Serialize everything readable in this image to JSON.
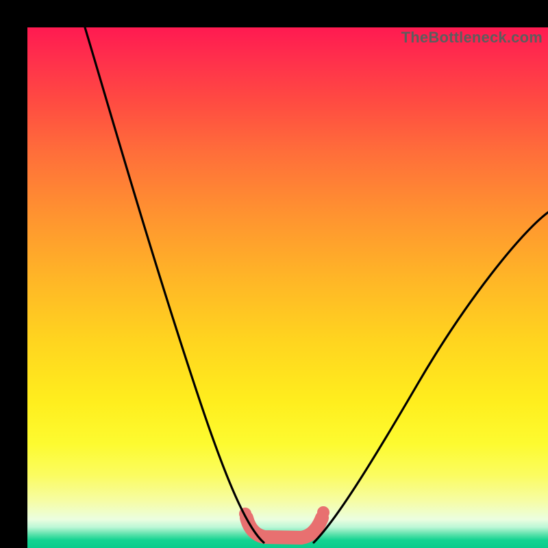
{
  "watermark_text": "TheBottleneck.com",
  "chart_data": {
    "type": "line",
    "title": "",
    "xlabel": "",
    "ylabel": "",
    "xlim": [
      0,
      100
    ],
    "ylim": [
      0,
      100
    ],
    "series": [
      {
        "name": "left-curve",
        "x": [
          11,
          15,
          20,
          25,
          30,
          35,
          38,
          41,
          43,
          45
        ],
        "y": [
          100,
          90,
          78,
          64,
          48,
          30,
          18,
          8,
          2,
          0
        ]
      },
      {
        "name": "right-curve",
        "x": [
          55,
          58,
          62,
          68,
          76,
          86,
          98,
          100
        ],
        "y": [
          0,
          4,
          10,
          20,
          34,
          48,
          62,
          64
        ]
      }
    ],
    "annotations": [
      {
        "name": "valley-ornament",
        "approx_x_range": [
          42,
          57
        ],
        "approx_y": 1
      }
    ],
    "background_gradient": {
      "top_color": "#ff1a51",
      "mid_color": "#ffee1e",
      "bottom_color": "#0acb8c"
    }
  }
}
